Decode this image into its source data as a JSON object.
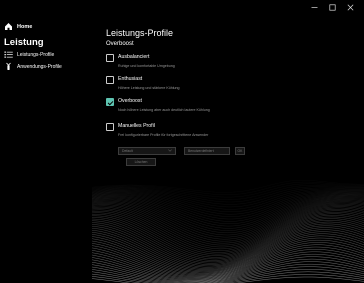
{
  "window": {
    "controls": [
      "minimize",
      "maximize",
      "close"
    ]
  },
  "sidebar": {
    "home_label": "Home",
    "section_label": "Leistung",
    "items": [
      {
        "label": "Leistungs-Profile",
        "icon": "list-icon"
      },
      {
        "label": "Anwendungs-Profile",
        "icon": "app-profile-icon"
      }
    ]
  },
  "main": {
    "title": "Leistungs-Profile",
    "current_profile": "Overboost",
    "options": [
      {
        "label": "Ausbalanciert",
        "desc": "Ruhige und komfortable Umgebung",
        "checked": false
      },
      {
        "label": "Enthusiast",
        "desc": "Höhere Leistung und stärkere Kühlung",
        "checked": false
      },
      {
        "label": "Overboost",
        "desc": "Noch höhere Leistung aber auch deutlich lautere Kühlung",
        "checked": true
      },
      {
        "label": "Manuelles Profil",
        "desc": "Frei konfigurierbare Profile für fortgeschrittene Anwender",
        "checked": false
      }
    ],
    "manual": {
      "preset_value": "Default",
      "name_placeholder": "Benutzerdefiniert",
      "ok_label": "OK",
      "delete_label": "Löschen"
    }
  },
  "colors": {
    "background": "#000000",
    "accent": "#5ec4b1"
  }
}
